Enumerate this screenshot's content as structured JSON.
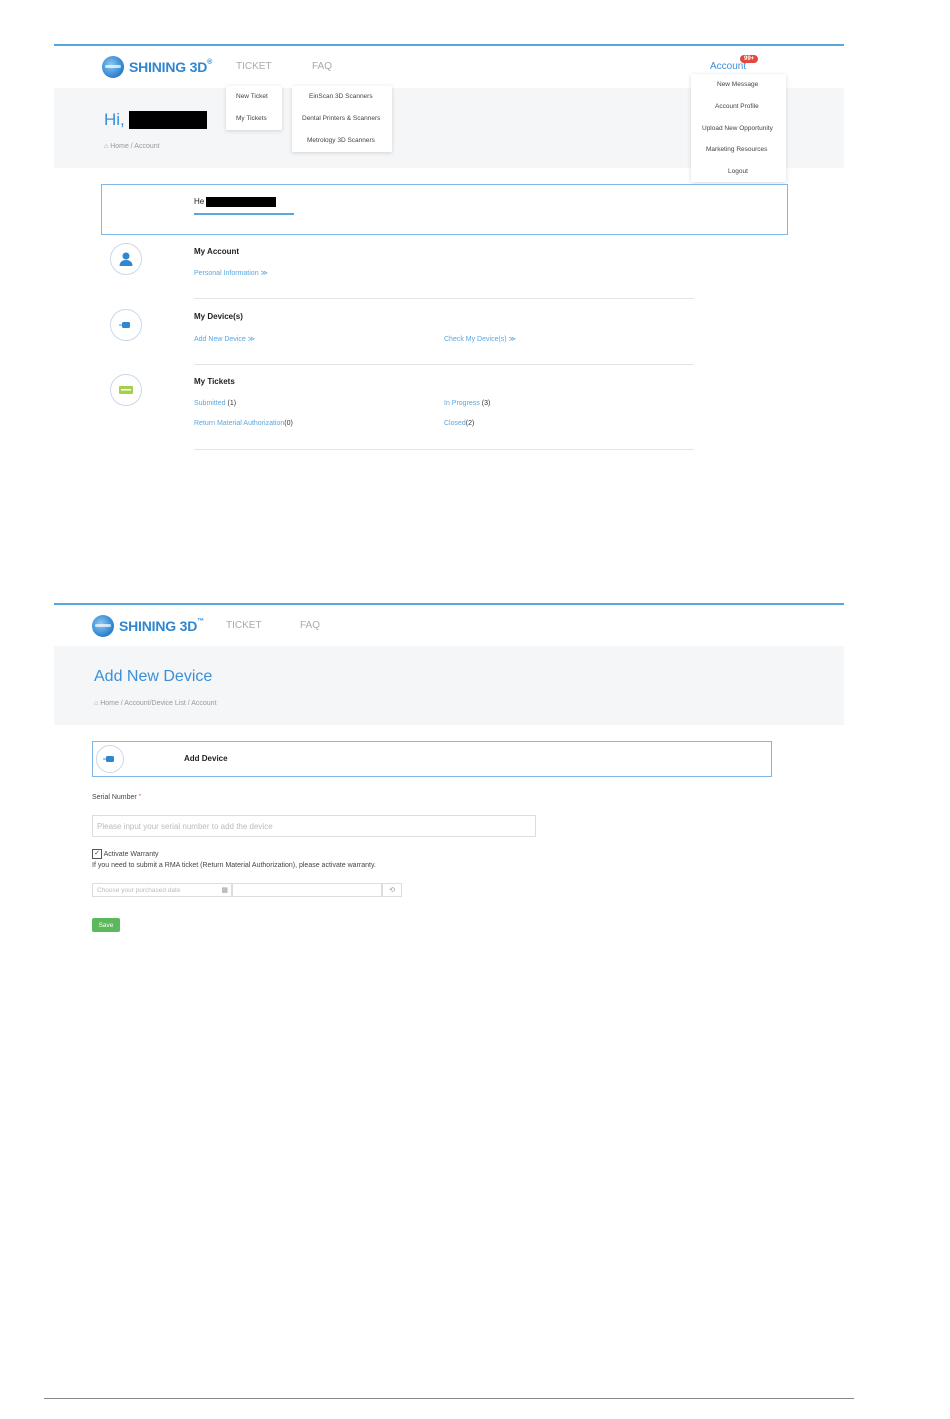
{
  "screen1": {
    "logo_text": "SHINING 3D",
    "logo_tm": "®",
    "nav": {
      "ticket": "TICKET",
      "faq": "FAQ",
      "account": "Account",
      "badge": "99+"
    },
    "ticket_menu": [
      "New Ticket",
      "My Tickets"
    ],
    "faq_menu": [
      "EinScan 3D Scanners",
      "Dental Printers & Scanners",
      "Metrology 3D Scanners"
    ],
    "account_menu": [
      "New Message",
      "Account Profile",
      "Upload New Opportunity",
      "Marketing Resources",
      "Logout"
    ],
    "greeting": "Hi,",
    "breadcrumb": "Home / Account",
    "card_hello": "He",
    "my_account": {
      "title": "My Account",
      "link": "Personal Information ≫"
    },
    "my_devices": {
      "title": "My Device(s)",
      "add": "Add New Device ≫",
      "check": "Check My Device(s) ≫"
    },
    "my_tickets": {
      "title": "My Tickets",
      "submitted": "Submitted",
      "submitted_count": "(1)",
      "in_progress": "In Progress",
      "in_progress_count": "(3)",
      "rma": "Return Material Authorization",
      "rma_count": "(0)",
      "closed": "Closed",
      "closed_count": "(2)"
    }
  },
  "screen2": {
    "logo_text": "SHINING 3D",
    "logo_tm": "™",
    "nav": {
      "ticket": "TICKET",
      "faq": "FAQ"
    },
    "page_title": "Add New Device",
    "breadcrumb": "Home / Account/Device List / Account",
    "card_title": "Add Device",
    "serial_label": "Serial Number",
    "required_mark": "*",
    "serial_placeholder": "Please input your serial number to add the device",
    "warranty_label": "Activate Warranty",
    "warranty_note": "If you need to submit a RMA ticket (Return Material Authorization), please activate warranty.",
    "date_placeholder": "Choose your purchased date",
    "save_label": "Save"
  },
  "colors": {
    "accent": "#3a8fd8",
    "badge": "#e4493e",
    "save": "#5cb85c"
  }
}
